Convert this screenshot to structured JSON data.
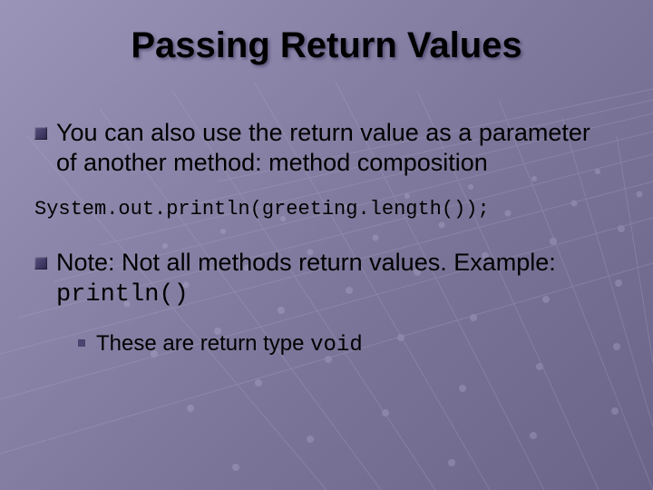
{
  "slide": {
    "title": "Passing Return Values",
    "bullet1": "You can also use the return value as a parameter of another method: method composition",
    "code": "System.out.println(greeting.length());",
    "bullet2_prefix": "Note: Not all methods return values. Example: ",
    "bullet2_code": "println()",
    "sub_prefix": "These are return type ",
    "sub_code": "void"
  }
}
